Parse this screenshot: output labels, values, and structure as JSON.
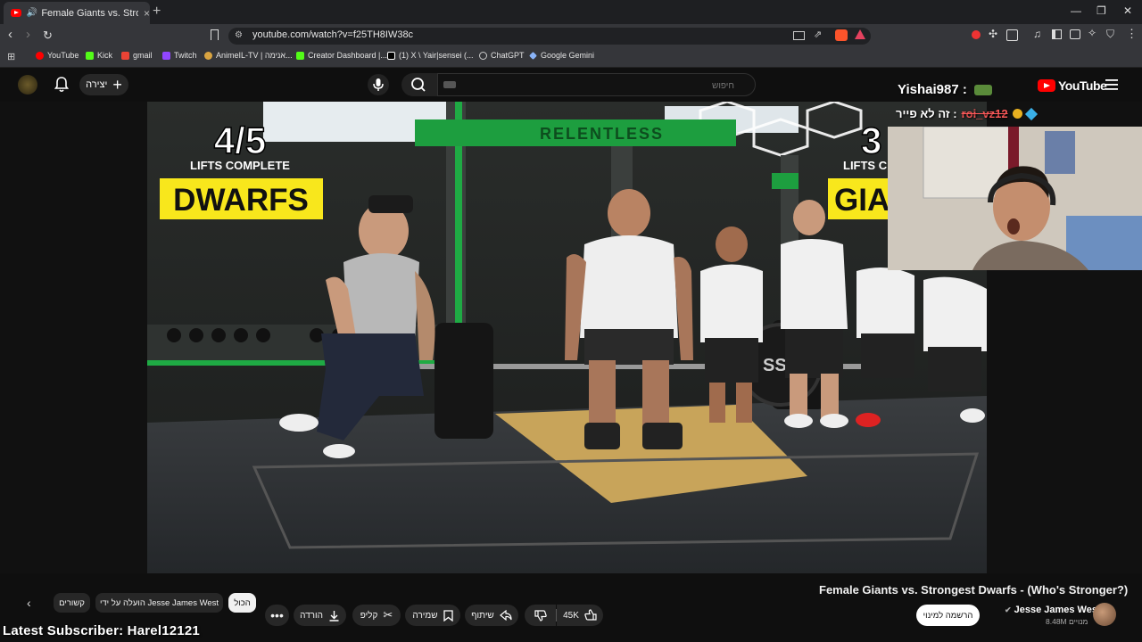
{
  "browser": {
    "tab_title": "Female Giants vs. Strongest D",
    "tab_close": "×",
    "new_tab": "+",
    "url": "youtube.com/watch?v=f25TH8IW38c",
    "bookmarks": [
      {
        "label": "YouTube",
        "color": "#ff0000"
      },
      {
        "label": "Kick",
        "color": "#53fc18"
      },
      {
        "label": "gmail",
        "color": "#ea4335"
      },
      {
        "label": "Twitch",
        "color": "#9146ff"
      },
      {
        "label": "AnimeIL-TV | אנימה...",
        "color": "#d9a441"
      },
      {
        "label": "Creator Dashboard |...",
        "color": "#53fc18"
      },
      {
        "label": "(1) X \\ Yair|sensei (...",
        "color": "#ffffff"
      },
      {
        "label": "ChatGPT",
        "color": "#cccccc"
      },
      {
        "label": "Google Gemini",
        "color": "#8ab4f8"
      }
    ]
  },
  "youtube": {
    "create_label": "יצירה",
    "search_placeholder": "חיפוש",
    "logo_text": "YouTube"
  },
  "overlay": {
    "chat_line1": "Yishai987 :",
    "chat_line2_text": "זה לא פייר :",
    "chat_line2_user": "roi_vz12",
    "latest_subscriber": "Latest Subscriber: Harel12121"
  },
  "thumbnail": {
    "left_count": "4/5",
    "left_sub": "LIFTS COMPLETE",
    "left_tag": "DWARFS",
    "right_count": "3",
    "right_sub": "LIFTS C",
    "right_tag": "GIA",
    "gym_sign": "RELENTLESS",
    "plate_text": "SS"
  },
  "video": {
    "title": "Female Giants vs. Strongest Dwarfs - (Who's Stronger?)",
    "channel": "Jesse James West",
    "subscribers": "8.48M מנויים",
    "subscribe_label": "הרשמה למינוי",
    "likes": "45K",
    "share_label": "שיתוף",
    "save_label": "שמירה",
    "clip_label": "קליפ",
    "download_label": "הורדה",
    "chips": {
      "all": "הכול",
      "uploaded_by": "הועלה על ידי Jesse James West",
      "related": "קשורים"
    }
  }
}
